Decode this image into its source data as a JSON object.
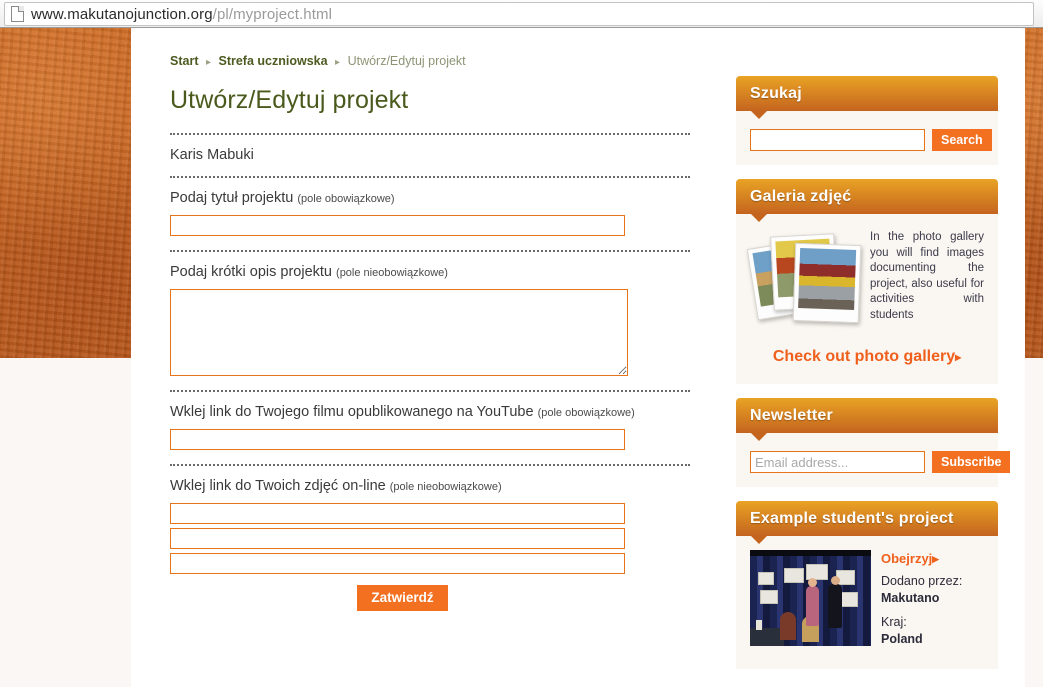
{
  "browser": {
    "url_domain": "www.makutanojunction.org",
    "url_path": "/pl/myproject.html"
  },
  "breadcrumb": {
    "items": [
      {
        "label": "Start",
        "current": false
      },
      {
        "label": "Strefa uczniowska",
        "current": false
      },
      {
        "label": "Utwórz/Edytuj projekt",
        "current": true
      }
    ],
    "separator": "▸"
  },
  "main": {
    "page_title": "Utwórz/Edytuj projekt",
    "user_name": "Karis Mabuki",
    "fields": [
      {
        "label": "Podaj tytuł projektu",
        "hint": "(pole obowiązkowe)",
        "value": "",
        "type": "text"
      },
      {
        "label": "Podaj krótki opis projektu",
        "hint": "(pole nieobowiązkowe)",
        "value": "",
        "type": "textarea"
      },
      {
        "label": "Wklej link do Twojego filmu opublikowanego na YouTube",
        "hint": "(pole obowiązkowe)",
        "value": "",
        "type": "text"
      },
      {
        "label": "Wklej link do Twoich zdjęć on-line",
        "hint": "(pole nieobowiązkowe)",
        "value": "",
        "type": "text-multi"
      }
    ],
    "photo_links": [
      "",
      "",
      ""
    ],
    "submit_label": "Zatwierdź"
  },
  "sidebar": {
    "search": {
      "title": "Szukaj",
      "input_value": "",
      "input_placeholder": "",
      "button_label": "Search"
    },
    "gallery": {
      "title": "Galeria zdjęć",
      "description": "In the photo gallery you will find images documenting the project, also useful for activities with students",
      "cta_label": "Check out photo gallery",
      "cta_caret": "▸"
    },
    "newsletter": {
      "title": "Newsletter",
      "input_value": "",
      "input_placeholder": "Email address...",
      "button_label": "Subscribe"
    },
    "example": {
      "title": "Example student's project",
      "watch_label": "Obejrzyj",
      "watch_caret": "▸",
      "added_by_label": "Dodano przez:",
      "added_by_value": "Makutano",
      "country_label": "Kraj:",
      "country_value": "Poland"
    }
  },
  "colors": {
    "accent_orange": "#f37021",
    "header_gradient_top": "#e9a324",
    "header_gradient_bottom": "#c4641f",
    "texture_orange": "#c4601f",
    "title_green": "#4a5a1c",
    "widget_body": "#faf6f1"
  }
}
